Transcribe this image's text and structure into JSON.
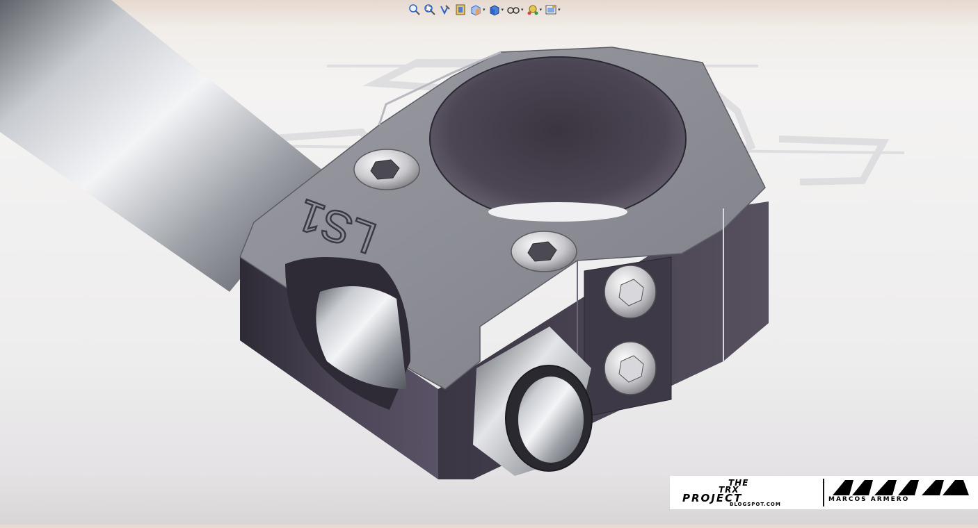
{
  "toolbar": {
    "items": [
      {
        "name": "zoom-to-fit-icon",
        "has_dropdown": false
      },
      {
        "name": "zoom-to-area-icon",
        "has_dropdown": false
      },
      {
        "name": "previous-view-icon",
        "has_dropdown": false
      },
      {
        "name": "section-view-icon",
        "has_dropdown": false
      },
      {
        "name": "view-orientation-icon",
        "has_dropdown": true
      },
      {
        "name": "display-style-icon",
        "has_dropdown": true
      },
      {
        "name": "hide-show-items-icon",
        "has_dropdown": true
      },
      {
        "name": "edit-appearance-icon",
        "has_dropdown": true
      },
      {
        "name": "apply-scene-icon",
        "has_dropdown": true
      }
    ],
    "dropdown_glyph": "▾"
  },
  "model": {
    "engraving": "LS1"
  },
  "watermark": {
    "left_lines": [
      "THE",
      "TRX",
      "PROJECT",
      "BLOGSPOT.COM"
    ],
    "right_label": "MARCOS ARMERO"
  },
  "colors": {
    "part_face": "#8f9097",
    "part_dark": "#3f3b47",
    "tube": "#a8acb2",
    "toolbar_accent": "#2f63c9"
  }
}
